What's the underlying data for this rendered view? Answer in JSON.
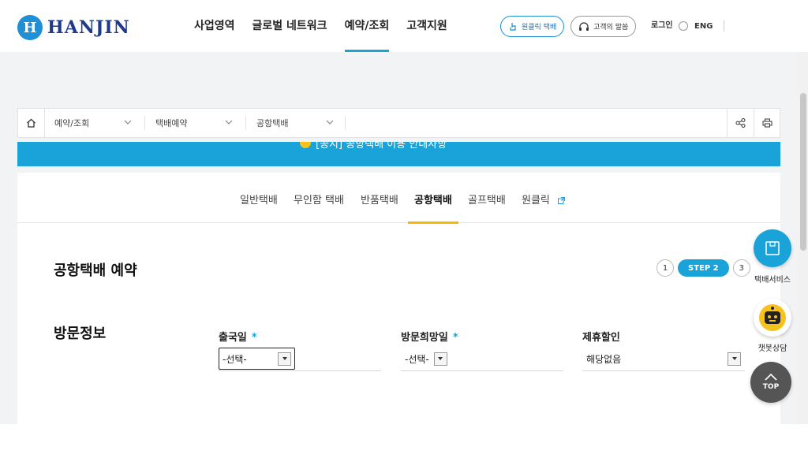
{
  "header": {
    "logo_text": "HANJIN",
    "logo_mark": "H",
    "nav": [
      "사업영역",
      "글로벌 네트워크",
      "예약/조회",
      "고객지원"
    ],
    "active_nav": "예약/조회",
    "pill_oneclick": "원클릭 택배",
    "pill_voice": "고객의 말씀",
    "login": "로그인",
    "lang": "ENG",
    "icons": [
      "search-icon",
      "menu-icon"
    ]
  },
  "breadcrumb": {
    "items": [
      "예약/조회",
      "택배예약",
      "공항택배"
    ],
    "tools": [
      "share-icon",
      "print-icon"
    ]
  },
  "banner": {
    "text": "[공지] 공항택배 이용 안내사항"
  },
  "tabs": {
    "items": [
      "일반택배",
      "무인함 택배",
      "반품택배",
      "공항택배",
      "골프택배",
      "원클릭"
    ],
    "active": "공항택배"
  },
  "content": {
    "title": "공항택배 예약",
    "steps": [
      "1",
      "STEP 2",
      "3"
    ],
    "section_title": "방문정보",
    "fields": [
      {
        "label": "출국일",
        "required": "*",
        "value": "-선택-"
      },
      {
        "label": "방문희망일",
        "required": "*",
        "value": "-선택-"
      },
      {
        "label": "제휴할인",
        "required": "",
        "value": "해당없음"
      }
    ]
  },
  "floating": {
    "service_label": "택배서비스",
    "chatbot_label": "챗봇상담",
    "top_label": "TOP"
  },
  "colors": {
    "accent": "#1aa3d9",
    "brand": "#1f3a8a",
    "tab_underline": "#f6b800"
  }
}
